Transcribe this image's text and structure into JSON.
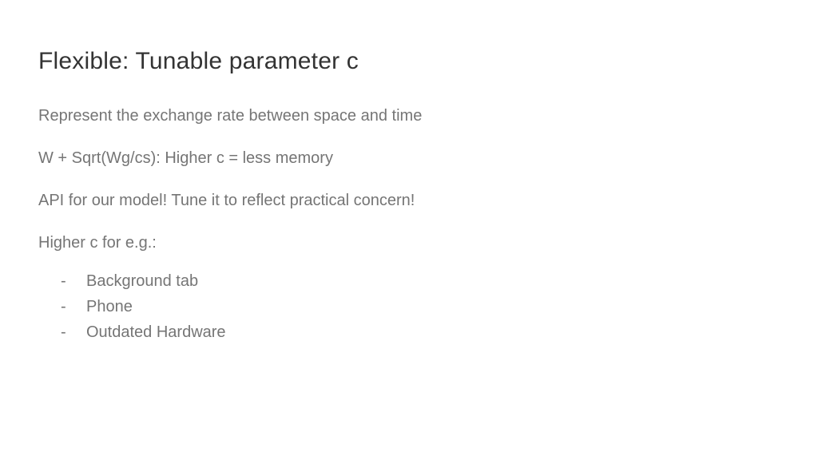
{
  "slide": {
    "title": "Flexible: Tunable parameter c",
    "paragraphs": [
      "Represent the exchange rate between space and time",
      "W + Sqrt(Wg/cs): Higher c = less memory",
      "API for our model! Tune it to reflect practical concern!",
      "Higher c for e.g.:"
    ],
    "bullets": [
      "Background tab",
      "Phone",
      "Outdated Hardware"
    ]
  }
}
